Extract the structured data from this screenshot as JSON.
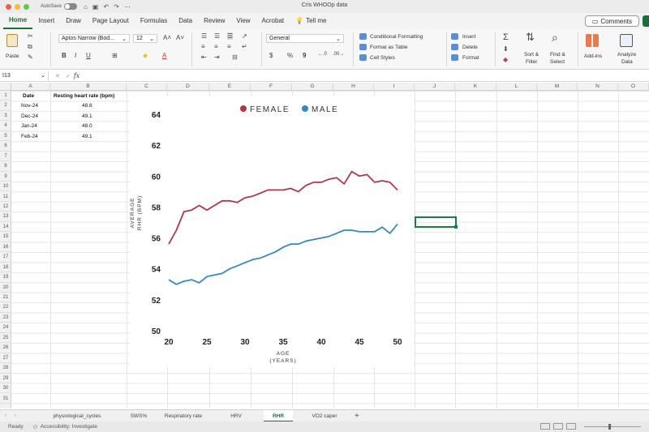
{
  "window": {
    "title": "Cris WHOOp data",
    "autosave_label": "AutoSave"
  },
  "ribbon_tabs": [
    "Home",
    "Insert",
    "Draw",
    "Page Layout",
    "Formulas",
    "Data",
    "Review",
    "View",
    "Acrobat"
  ],
  "tell_me": "Tell me",
  "comments_label": "Comments",
  "ribbon": {
    "paste_label": "Paste",
    "font_name": "Aptos Narrow (Bod...",
    "font_size": "12",
    "number_format": "General",
    "conditional_formatting": "Conditional Formatting",
    "format_as_table": "Format as Table",
    "cell_styles": "Cell Styles",
    "insert": "Insert",
    "delete": "Delete",
    "format": "Format",
    "sort_filter_1": "Sort &",
    "sort_filter_2": "Filter",
    "find_select_1": "Find &",
    "find_select_2": "Select",
    "addins": "Add-ins",
    "analyze_1": "Analyze",
    "analyze_2": "Data",
    "currency_symbol": "$",
    "percent_symbol": "%",
    "comma_symbol": "9",
    "sum_symbol": "Σ"
  },
  "formula_bar": {
    "name_box": "I13",
    "fx": "fx",
    "value": ""
  },
  "columns": [
    "A",
    "B",
    "C",
    "D",
    "E",
    "F",
    "G",
    "H",
    "I",
    "J",
    "K",
    "L",
    "M",
    "N",
    "O"
  ],
  "rows": [
    "1",
    "2",
    "3",
    "4",
    "5",
    "6",
    "7",
    "8",
    "9",
    "10",
    "11",
    "12",
    "13",
    "14",
    "15",
    "16",
    "17",
    "18",
    "19",
    "20",
    "21",
    "22",
    "23",
    "24",
    "25",
    "26",
    "27",
    "28",
    "29",
    "30",
    "31"
  ],
  "table": {
    "headers": [
      "Date",
      "Resting heart rate (bpm)"
    ],
    "rows": [
      [
        "Nov-24",
        "48.6"
      ],
      [
        "Dec-24",
        "49.1"
      ],
      [
        "Jan-24",
        "48.0"
      ],
      [
        "Feb-24",
        "49.1"
      ]
    ]
  },
  "chart_data": {
    "type": "line",
    "title": "",
    "xlabel": [
      "AGE",
      "(YEARS)"
    ],
    "ylabel": [
      "AVERAGE",
      "RHR (BPM)"
    ],
    "xlim": [
      20,
      50
    ],
    "ylim": [
      50,
      64
    ],
    "xticks": [
      "20",
      "25",
      "30",
      "35",
      "40",
      "45",
      "50"
    ],
    "yticks": [
      "50",
      "52",
      "54",
      "56",
      "58",
      "60",
      "62",
      "64"
    ],
    "legend_position": "top",
    "grid": false,
    "x": [
      20,
      21,
      22,
      23,
      24,
      25,
      26,
      27,
      28,
      29,
      30,
      31,
      32,
      33,
      34,
      35,
      36,
      37,
      38,
      39,
      40,
      41,
      42,
      43,
      44,
      45,
      46,
      47,
      48,
      49,
      50
    ],
    "series": [
      {
        "name": "FEMALE",
        "color": "#a83a4e",
        "values": [
          55.6,
          56.5,
          57.7,
          57.8,
          58.1,
          57.8,
          58.1,
          58.4,
          58.4,
          58.3,
          58.6,
          58.7,
          58.9,
          59.1,
          59.1,
          59.1,
          59.2,
          59.0,
          59.4,
          59.6,
          59.6,
          59.8,
          59.9,
          59.5,
          60.3,
          60.0,
          60.1,
          59.6,
          59.7,
          59.6,
          59.1
        ]
      },
      {
        "name": "MALE",
        "color": "#3b87b8",
        "values": [
          53.3,
          53.0,
          53.2,
          53.3,
          53.1,
          53.5,
          53.6,
          53.7,
          54.0,
          54.2,
          54.4,
          54.6,
          54.7,
          54.9,
          55.1,
          55.4,
          55.6,
          55.6,
          55.8,
          55.9,
          56.0,
          56.1,
          56.3,
          56.5,
          56.5,
          56.4,
          56.4,
          56.4,
          56.7,
          56.3,
          56.9
        ]
      }
    ]
  },
  "sheet_tabs": [
    "physiological_cycles",
    "SWS%",
    "Respiratory rate",
    "HRV",
    "RHR",
    "VO2 caper"
  ],
  "active_sheet": "RHR",
  "status": {
    "ready": "Ready",
    "accessibility": "Accessibility: Investigate"
  }
}
